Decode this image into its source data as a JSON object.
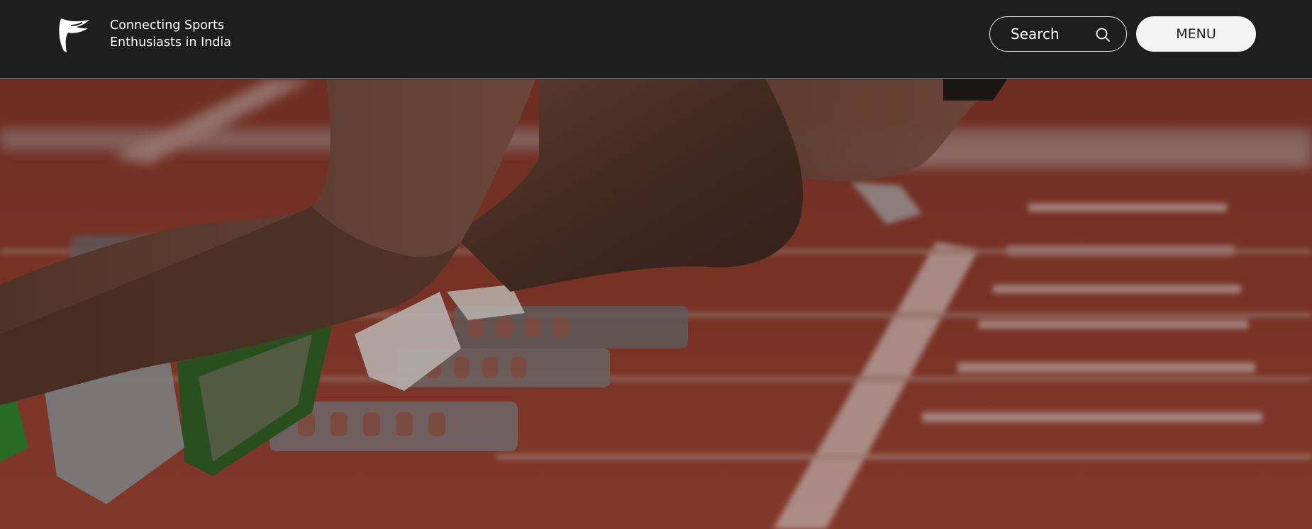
{
  "header": {
    "tagline_line1": "Connecting Sports",
    "tagline_line2": "Enthusiasts in India",
    "search_label": "Search",
    "menu_label": "MENU"
  },
  "hero": {
    "image_subject": "sprinters-at-starting-blocks"
  },
  "colors": {
    "header_bg": "#1e1e1e",
    "menu_bg": "#f3f3f3",
    "track": "#8a3a2c"
  }
}
